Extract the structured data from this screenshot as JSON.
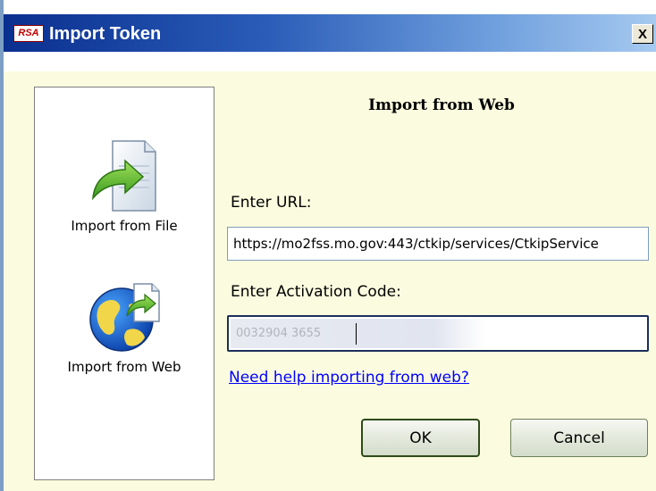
{
  "window": {
    "title": "Import Token",
    "logo_text": "RSA",
    "close_label": "X"
  },
  "sidebar": {
    "items": [
      {
        "label": "Import from File",
        "icon": "import-file-icon"
      },
      {
        "label": "Import from Web",
        "icon": "import-web-globe-icon"
      }
    ]
  },
  "main": {
    "section_title": "Import from Web",
    "url_label": "Enter URL:",
    "url_value": "https://mo2fss.mo.gov:443/ctkip/services/CtkipService",
    "code_label": "Enter Activation Code:",
    "code_value": "0032904 3655",
    "help_link": "Need help importing from web?"
  },
  "buttons": {
    "ok_label": "OK",
    "cancel_label": "Cancel"
  },
  "colors": {
    "dialog_background": "#fbfcdf",
    "title_gradient_start": "#0a2f8f",
    "title_gradient_end": "#a6caf0",
    "link": "#0000ff",
    "logo_red": "#c40000"
  }
}
